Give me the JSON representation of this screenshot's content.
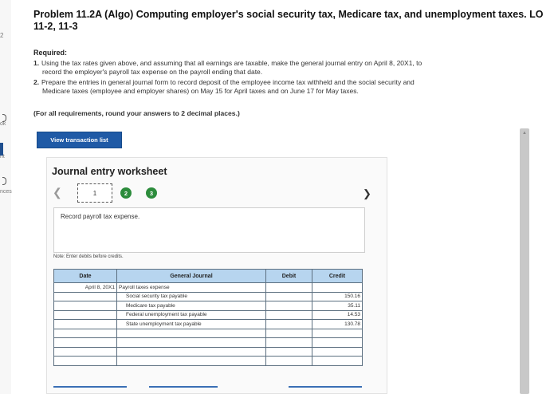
{
  "left_rail": {
    "q_num": "2",
    "label_ok": "ok",
    "label_t": "nt",
    "label_ences": "nces"
  },
  "title": "Problem 11.2A (Algo) Computing employer's social security tax, Medicare tax, and unemployment taxes. LO 11-2, 11-3",
  "required": {
    "heading": "Required:",
    "item1_num": "1.",
    "item1_line1": "Using the tax rates given above, and assuming that all earnings are taxable, make the general journal entry on April 8, 20X1, to",
    "item1_line2": "record the employer's payroll tax expense on the payroll ending that date.",
    "item2_num": "2.",
    "item2_line1": "Prepare the entries in general journal form to record deposit of the employee income tax withheld and the social security and",
    "item2_line2": "Medicare taxes (employee and employer shares) on May 15 for April taxes and on June 17 for May taxes."
  },
  "rounding_note": "(For all requirements, round your answers to 2 decimal places.)",
  "view_button": "View transaction list",
  "worksheet": {
    "title": "Journal entry worksheet",
    "pages": [
      "1",
      "2",
      "3"
    ],
    "instruction": "Record payroll tax expense.",
    "note": "Note: Enter debits before credits.",
    "columns": {
      "date": "Date",
      "general_journal": "General Journal",
      "debit": "Debit",
      "credit": "Credit"
    },
    "rows": [
      {
        "date": "April 8, 20X1",
        "account": "Payroll taxes expense",
        "debit": "",
        "credit": ""
      },
      {
        "date": "",
        "account": "Social security tax payable",
        "debit": "",
        "credit": "150.16"
      },
      {
        "date": "",
        "account": "Medicare tax payable",
        "debit": "",
        "credit": "35.11"
      },
      {
        "date": "",
        "account": "Federal unemployment tax payable",
        "debit": "",
        "credit": "14.53"
      },
      {
        "date": "",
        "account": "State unemployment tax payable",
        "debit": "",
        "credit": "130.78"
      }
    ]
  },
  "colors": {
    "accent": "#1f5aa6",
    "header_bg": "#b7d5ef",
    "page_circle": "#2c8c3c"
  }
}
